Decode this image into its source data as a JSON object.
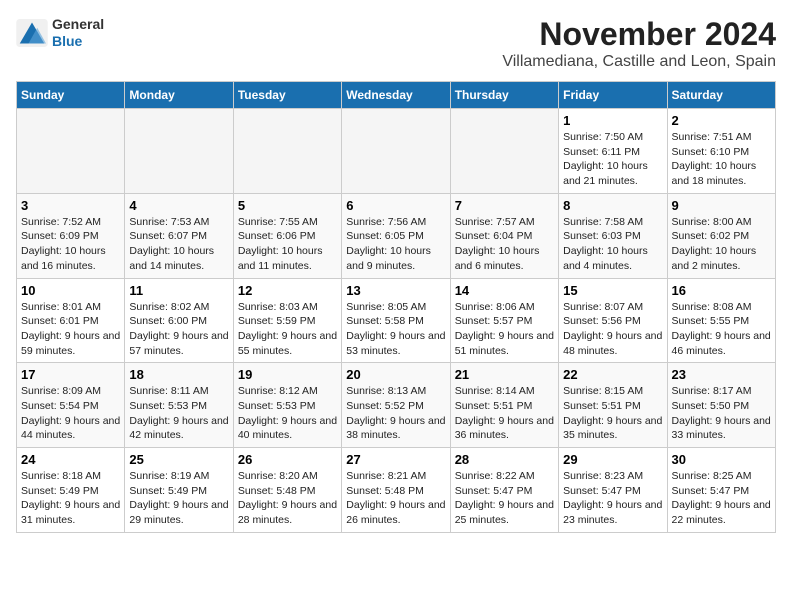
{
  "header": {
    "logo_general": "General",
    "logo_blue": "Blue",
    "month_title": "November 2024",
    "location": "Villamediana, Castille and Leon, Spain"
  },
  "weekdays": [
    "Sunday",
    "Monday",
    "Tuesday",
    "Wednesday",
    "Thursday",
    "Friday",
    "Saturday"
  ],
  "weeks": [
    [
      {
        "day": "",
        "info": ""
      },
      {
        "day": "",
        "info": ""
      },
      {
        "day": "",
        "info": ""
      },
      {
        "day": "",
        "info": ""
      },
      {
        "day": "",
        "info": ""
      },
      {
        "day": "1",
        "info": "Sunrise: 7:50 AM\nSunset: 6:11 PM\nDaylight: 10 hours and 21 minutes."
      },
      {
        "day": "2",
        "info": "Sunrise: 7:51 AM\nSunset: 6:10 PM\nDaylight: 10 hours and 18 minutes."
      }
    ],
    [
      {
        "day": "3",
        "info": "Sunrise: 7:52 AM\nSunset: 6:09 PM\nDaylight: 10 hours and 16 minutes."
      },
      {
        "day": "4",
        "info": "Sunrise: 7:53 AM\nSunset: 6:07 PM\nDaylight: 10 hours and 14 minutes."
      },
      {
        "day": "5",
        "info": "Sunrise: 7:55 AM\nSunset: 6:06 PM\nDaylight: 10 hours and 11 minutes."
      },
      {
        "day": "6",
        "info": "Sunrise: 7:56 AM\nSunset: 6:05 PM\nDaylight: 10 hours and 9 minutes."
      },
      {
        "day": "7",
        "info": "Sunrise: 7:57 AM\nSunset: 6:04 PM\nDaylight: 10 hours and 6 minutes."
      },
      {
        "day": "8",
        "info": "Sunrise: 7:58 AM\nSunset: 6:03 PM\nDaylight: 10 hours and 4 minutes."
      },
      {
        "day": "9",
        "info": "Sunrise: 8:00 AM\nSunset: 6:02 PM\nDaylight: 10 hours and 2 minutes."
      }
    ],
    [
      {
        "day": "10",
        "info": "Sunrise: 8:01 AM\nSunset: 6:01 PM\nDaylight: 9 hours and 59 minutes."
      },
      {
        "day": "11",
        "info": "Sunrise: 8:02 AM\nSunset: 6:00 PM\nDaylight: 9 hours and 57 minutes."
      },
      {
        "day": "12",
        "info": "Sunrise: 8:03 AM\nSunset: 5:59 PM\nDaylight: 9 hours and 55 minutes."
      },
      {
        "day": "13",
        "info": "Sunrise: 8:05 AM\nSunset: 5:58 PM\nDaylight: 9 hours and 53 minutes."
      },
      {
        "day": "14",
        "info": "Sunrise: 8:06 AM\nSunset: 5:57 PM\nDaylight: 9 hours and 51 minutes."
      },
      {
        "day": "15",
        "info": "Sunrise: 8:07 AM\nSunset: 5:56 PM\nDaylight: 9 hours and 48 minutes."
      },
      {
        "day": "16",
        "info": "Sunrise: 8:08 AM\nSunset: 5:55 PM\nDaylight: 9 hours and 46 minutes."
      }
    ],
    [
      {
        "day": "17",
        "info": "Sunrise: 8:09 AM\nSunset: 5:54 PM\nDaylight: 9 hours and 44 minutes."
      },
      {
        "day": "18",
        "info": "Sunrise: 8:11 AM\nSunset: 5:53 PM\nDaylight: 9 hours and 42 minutes."
      },
      {
        "day": "19",
        "info": "Sunrise: 8:12 AM\nSunset: 5:53 PM\nDaylight: 9 hours and 40 minutes."
      },
      {
        "day": "20",
        "info": "Sunrise: 8:13 AM\nSunset: 5:52 PM\nDaylight: 9 hours and 38 minutes."
      },
      {
        "day": "21",
        "info": "Sunrise: 8:14 AM\nSunset: 5:51 PM\nDaylight: 9 hours and 36 minutes."
      },
      {
        "day": "22",
        "info": "Sunrise: 8:15 AM\nSunset: 5:51 PM\nDaylight: 9 hours and 35 minutes."
      },
      {
        "day": "23",
        "info": "Sunrise: 8:17 AM\nSunset: 5:50 PM\nDaylight: 9 hours and 33 minutes."
      }
    ],
    [
      {
        "day": "24",
        "info": "Sunrise: 8:18 AM\nSunset: 5:49 PM\nDaylight: 9 hours and 31 minutes."
      },
      {
        "day": "25",
        "info": "Sunrise: 8:19 AM\nSunset: 5:49 PM\nDaylight: 9 hours and 29 minutes."
      },
      {
        "day": "26",
        "info": "Sunrise: 8:20 AM\nSunset: 5:48 PM\nDaylight: 9 hours and 28 minutes."
      },
      {
        "day": "27",
        "info": "Sunrise: 8:21 AM\nSunset: 5:48 PM\nDaylight: 9 hours and 26 minutes."
      },
      {
        "day": "28",
        "info": "Sunrise: 8:22 AM\nSunset: 5:47 PM\nDaylight: 9 hours and 25 minutes."
      },
      {
        "day": "29",
        "info": "Sunrise: 8:23 AM\nSunset: 5:47 PM\nDaylight: 9 hours and 23 minutes."
      },
      {
        "day": "30",
        "info": "Sunrise: 8:25 AM\nSunset: 5:47 PM\nDaylight: 9 hours and 22 minutes."
      }
    ]
  ]
}
